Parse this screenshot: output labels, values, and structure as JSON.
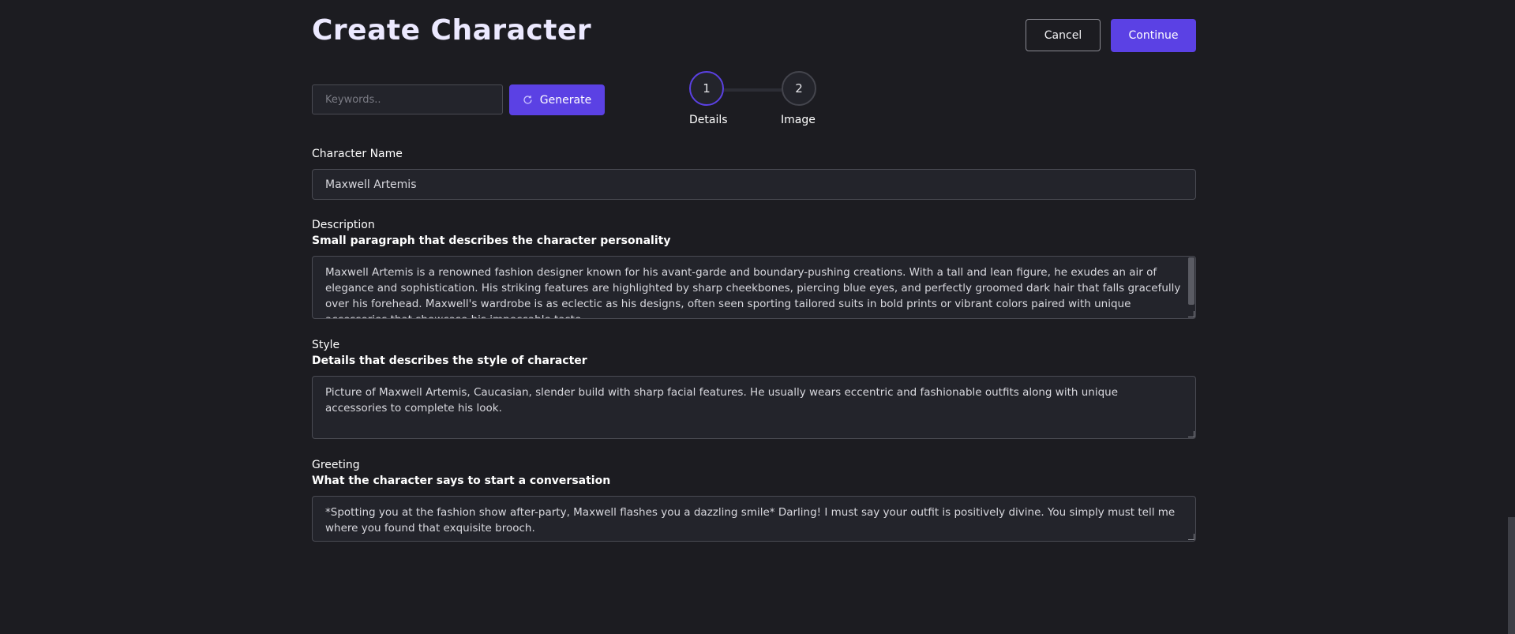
{
  "header": {
    "title": "Create Character",
    "cancel_label": "Cancel",
    "continue_label": "Continue"
  },
  "generator": {
    "keywords_placeholder": "Keywords..",
    "keywords_value": "",
    "generate_label": "Generate",
    "generate_icon": "refresh-icon"
  },
  "stepper": {
    "steps": [
      {
        "number": "1",
        "label": "Details",
        "active": true
      },
      {
        "number": "2",
        "label": "Image",
        "active": false
      }
    ]
  },
  "form": {
    "name": {
      "label": "Character Name",
      "value": "Maxwell Artemis"
    },
    "description": {
      "label": "Description",
      "sublabel": "Small paragraph that describes the character personality",
      "value": "Maxwell Artemis is a renowned fashion designer known for his avant-garde and boundary-pushing creations. With a tall and lean figure, he exudes an air of elegance and sophistication. His striking features are highlighted by sharp cheekbones, piercing blue eyes, and perfectly groomed dark hair that falls gracefully over his forehead. Maxwell's wardrobe is as eclectic as his designs, often seen sporting tailored suits in bold prints or vibrant colors paired with unique accessories that showcase his impeccable taste."
    },
    "style": {
      "label": "Style",
      "sublabel": "Details that describes the style of character",
      "value": "Picture of Maxwell Artemis, Caucasian, slender build with sharp facial features. He usually wears eccentric and fashionable outfits along with unique accessories to complete his look."
    },
    "greeting": {
      "label": "Greeting",
      "sublabel": "What the character says to start a conversation",
      "value": "*Spotting you at the fashion show after-party, Maxwell flashes you a dazzling smile* Darling! I must say your outfit is positively divine. You simply must tell me where you found that exquisite brooch."
    }
  },
  "colors": {
    "background": "#1c1c21",
    "accent": "#5b41e4",
    "field_bg": "#23242b",
    "field_border": "#4a4b53"
  }
}
